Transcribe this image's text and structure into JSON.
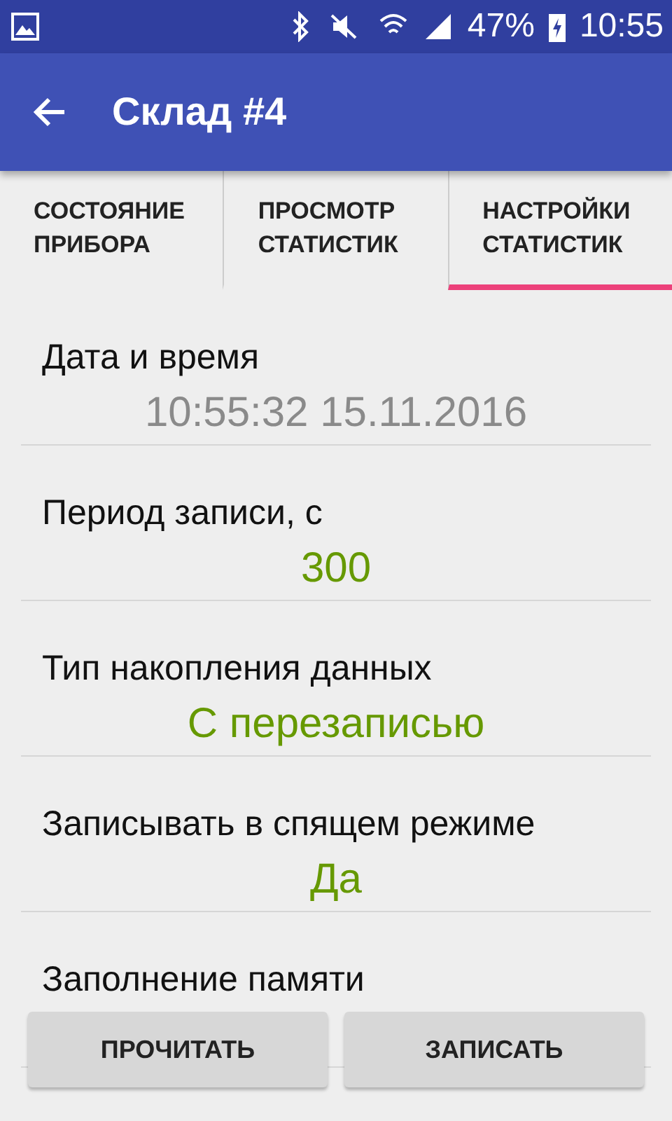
{
  "status_bar": {
    "battery": "47%",
    "time": "10:55"
  },
  "app_bar": {
    "title": "Склад #4"
  },
  "tabs": [
    {
      "label": "СОСТОЯНИЕ\nПРИБОРА",
      "selected": false
    },
    {
      "label": "ПРОСМОТР\nСТАТИСТИК",
      "selected": false
    },
    {
      "label": "НАСТРОЙКИ\nСТАТИСТИК",
      "selected": true
    }
  ],
  "settings": [
    {
      "label": "Дата и время",
      "value": "10:55:32 15.11.2016",
      "editable": false
    },
    {
      "label": "Период записи, с",
      "value": "300",
      "editable": true
    },
    {
      "label": "Тип накопления данных",
      "value": "С перезаписью",
      "editable": true
    },
    {
      "label": "Записывать в спящем режиме",
      "value": "Да",
      "editable": true
    },
    {
      "label": "Заполнение памяти"
    }
  ],
  "buttons": [
    "ПРОЧИТАТЬ",
    "ЗАПИСАТЬ"
  ]
}
